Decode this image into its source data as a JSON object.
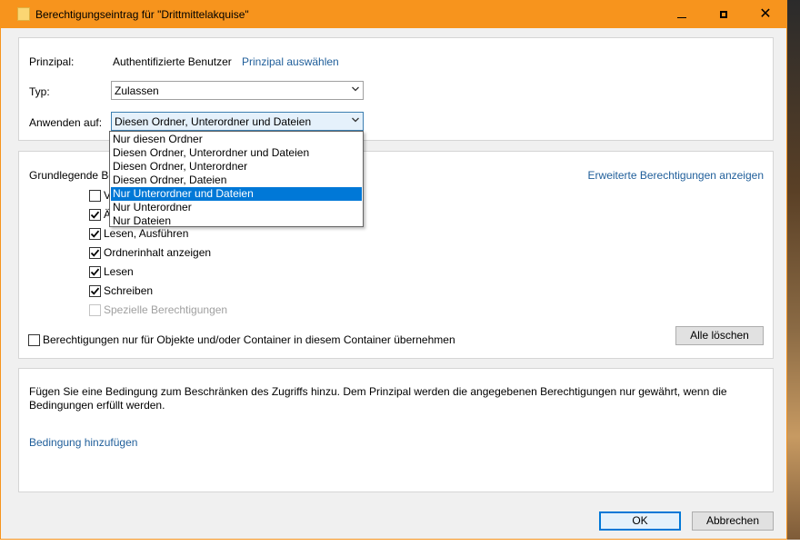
{
  "window": {
    "title": "Berechtigungseintrag für \"Drittmittelakquise\""
  },
  "principal": {
    "label": "Prinzipal:",
    "value": "Authentifizierte Benutzer",
    "select_link": "Prinzipal auswählen"
  },
  "type": {
    "label": "Typ:",
    "value": "Zulassen"
  },
  "apply_to": {
    "label": "Anwenden auf:",
    "value": "Diesen Ordner, Unterordner und Dateien",
    "options": [
      "Nur diesen Ordner",
      "Diesen Ordner, Unterordner und Dateien",
      "Diesen Ordner, Unterordner",
      "Diesen Ordner, Dateien",
      "Nur Unterordner und Dateien",
      "Nur Unterordner",
      "Nur Dateien"
    ],
    "highlighted_index": 4
  },
  "permissions": {
    "heading": "Grundlegende Be",
    "advanced_link": "Erweiterte Berechtigungen anzeigen",
    "items": [
      {
        "label": "V",
        "checked": false,
        "disabled": false
      },
      {
        "label": "Ä",
        "checked": true,
        "disabled": false
      },
      {
        "label": "Lesen, Ausführen",
        "checked": true,
        "disabled": false
      },
      {
        "label": "Ordnerinhalt anzeigen",
        "checked": true,
        "disabled": false
      },
      {
        "label": "Lesen",
        "checked": true,
        "disabled": false
      },
      {
        "label": "Schreiben",
        "checked": true,
        "disabled": false
      },
      {
        "label": "Spezielle Berechtigungen",
        "checked": false,
        "disabled": true
      }
    ],
    "inherit_label": "Berechtigungen nur für Objekte und/oder Container in diesem Container übernehmen",
    "inherit_checked": false,
    "clear_all": "Alle löschen"
  },
  "condition": {
    "text": "Fügen Sie eine Bedingung zum Beschränken des Zugriffs hinzu. Dem Prinzipal werden die angegebenen Berechtigungen nur gewährt, wenn die Bedingungen erfüllt werden.",
    "add_link": "Bedingung hinzufügen"
  },
  "footer": {
    "ok": "OK",
    "cancel": "Abbrechen"
  },
  "colors": {
    "titlebar": "#f7941d",
    "link": "#1f5e9a",
    "highlight": "#0078d7"
  }
}
